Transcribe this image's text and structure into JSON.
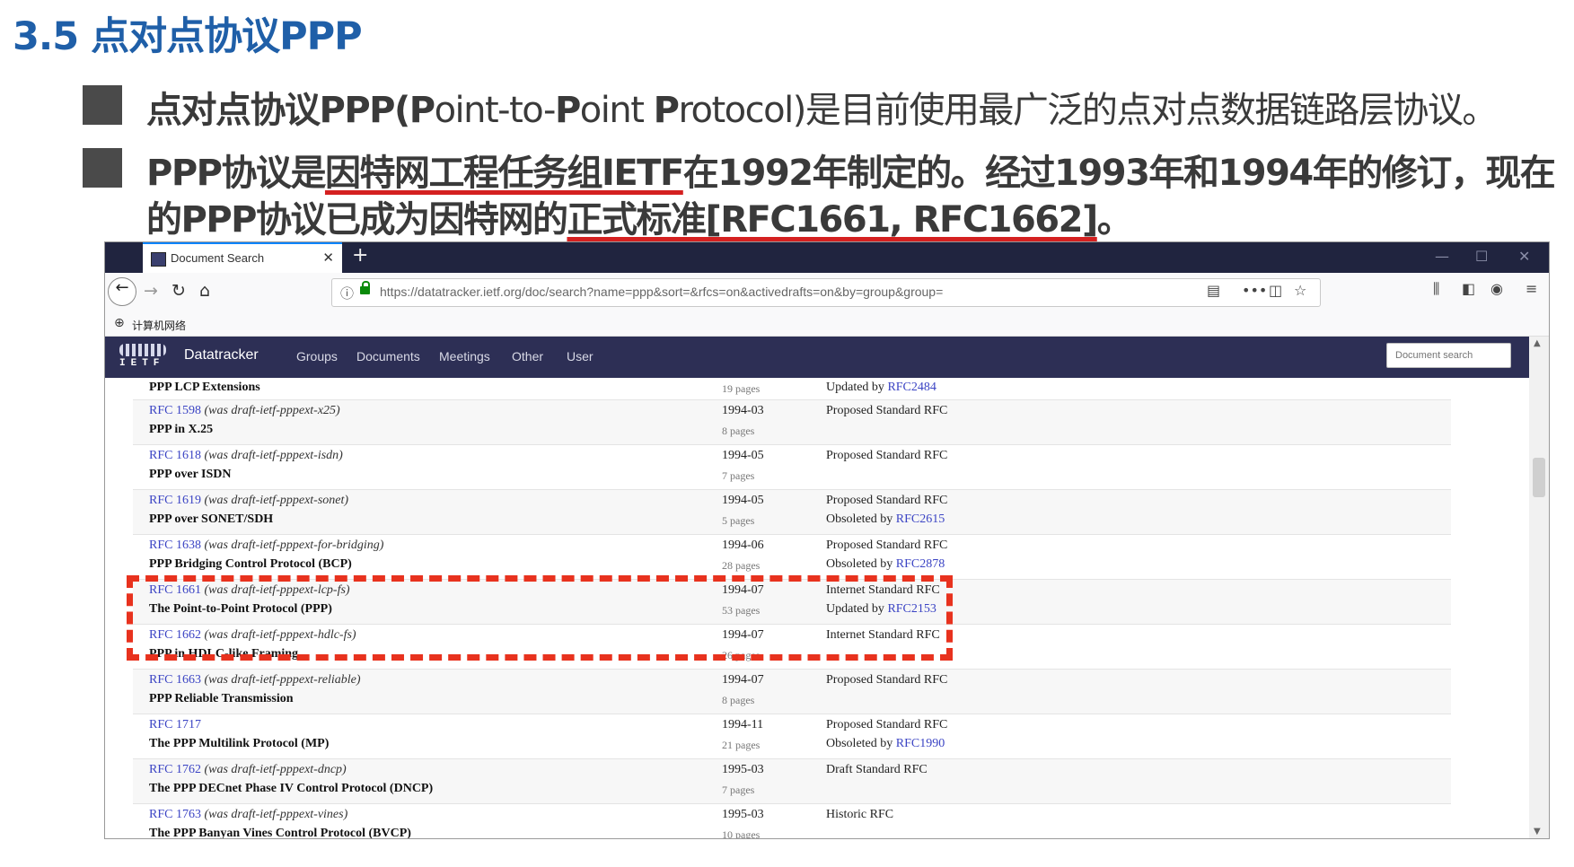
{
  "slide": {
    "title": "3.5 点对点协议PPP",
    "bullet1": {
      "p1": "点对点协议PPP(",
      "p2": "P",
      "p3": "oint-to-",
      "p4": "P",
      "p5": "oint ",
      "p6": "P",
      "p7": "rotocol)是目前使用最广泛的点对点数据链路层协议。"
    },
    "bullet2": {
      "line1_pre": "PPP协议是",
      "line1_hl": "因特网工程任务组IETF",
      "line1_post": "在1992年制定的。经过1993年和1994年的修订，现在",
      "line2_pre": "的PPP协议已成为因特网的",
      "line2_hl": "正式标准[RFC1661, RFC1662]",
      "line2_post": "。"
    }
  },
  "browser": {
    "tab_title": "Document Search",
    "tab_close": "✕",
    "new_tab": "+",
    "win_min": "—",
    "win_max": "☐",
    "win_close": "✕",
    "back": "←",
    "forward": "→",
    "reload": "↻",
    "home": "⌂",
    "url": "https://datatracker.ietf.org/doc/search?name=ppp&sort=&rfcs=on&activedrafts=on&by=group&group=",
    "url_info_icon": "ⓘ",
    "reader_icon": "▤",
    "more_icon": "•••",
    "pocket_icon": "◫",
    "star_icon": "☆",
    "library_icon": "⫼",
    "sidebar_icon": "◧",
    "account_icon": "◉",
    "menu_icon": "≡",
    "bookmark_icon": "⊕",
    "bookmark_label": "计算机网络"
  },
  "ietf": {
    "logo_text": "IETF",
    "brand": "Datatracker",
    "nav": [
      "Groups",
      "Documents",
      "Meetings",
      "Other",
      "User"
    ],
    "search_placeholder": "Document search"
  },
  "rows": [
    {
      "rfc": "",
      "was": "",
      "title": "PPP LCP Extensions",
      "date": "",
      "pages": "19 pages",
      "status": "",
      "status2_pre": "Updated by ",
      "status2_rfc": "RFC2484"
    },
    {
      "rfc": "RFC 1598",
      "was": " (was draft-ietf-pppext-x25)",
      "title": "PPP in X.25",
      "date": "1994-03",
      "pages": "8 pages",
      "status": "Proposed Standard RFC",
      "status2_pre": "",
      "status2_rfc": ""
    },
    {
      "rfc": "RFC 1618",
      "was": " (was draft-ietf-pppext-isdn)",
      "title": "PPP over ISDN",
      "date": "1994-05",
      "pages": "7 pages",
      "status": "Proposed Standard RFC",
      "status2_pre": "",
      "status2_rfc": ""
    },
    {
      "rfc": "RFC 1619",
      "was": " (was draft-ietf-pppext-sonet)",
      "title": "PPP over SONET/SDH",
      "date": "1994-05",
      "pages": "5 pages",
      "status": "Proposed Standard RFC",
      "status2_pre": "Obsoleted by ",
      "status2_rfc": "RFC2615"
    },
    {
      "rfc": "RFC 1638",
      "was": " (was draft-ietf-pppext-for-bridging)",
      "title": "PPP Bridging Control Protocol (BCP)",
      "date": "1994-06",
      "pages": "28 pages",
      "status": "Proposed Standard RFC",
      "status2_pre": "Obsoleted by ",
      "status2_rfc": "RFC2878"
    },
    {
      "rfc": "RFC 1661",
      "was": " (was draft-ietf-pppext-lcp-fs)",
      "title": "The Point-to-Point Protocol (PPP)",
      "date": "1994-07",
      "pages": "53 pages",
      "status": "Internet Standard RFC",
      "status2_pre": "Updated by ",
      "status2_rfc": "RFC2153"
    },
    {
      "rfc": "RFC 1662",
      "was": " (was draft-ietf-pppext-hdlc-fs)",
      "title": "PPP in HDLC-like Framing",
      "date": "1994-07",
      "pages": "26 pages",
      "status": "Internet Standard RFC",
      "status2_pre": "",
      "status2_rfc": ""
    },
    {
      "rfc": "RFC 1663",
      "was": " (was draft-ietf-pppext-reliable)",
      "title": "PPP Reliable Transmission",
      "date": "1994-07",
      "pages": "8 pages",
      "status": "Proposed Standard RFC",
      "status2_pre": "",
      "status2_rfc": ""
    },
    {
      "rfc": "RFC 1717",
      "was": "",
      "title": "The PPP Multilink Protocol (MP)",
      "date": "1994-11",
      "pages": "21 pages",
      "status": "Proposed Standard RFC",
      "status2_pre": "Obsoleted by ",
      "status2_rfc": "RFC1990"
    },
    {
      "rfc": "RFC 1762",
      "was": " (was draft-ietf-pppext-dncp)",
      "title": "The PPP DECnet Phase IV Control Protocol (DNCP)",
      "date": "1995-03",
      "pages": "7 pages",
      "status": "Draft Standard RFC",
      "status2_pre": "",
      "status2_rfc": ""
    },
    {
      "rfc": "RFC 1763",
      "was": " (was draft-ietf-pppext-vines)",
      "title": "The PPP Banyan Vines Control Protocol (BVCP)",
      "date": "1995-03",
      "pages": "10 pages",
      "status": "Historic RFC",
      "status2_pre": "",
      "status2_rfc": ""
    }
  ],
  "colors": {
    "slide_title": "#1f5fa8",
    "highlight": "#d42020",
    "dash_box": "#e8321e",
    "ietf_nav": "#2d2f55",
    "rfc_link": "#3b44c4"
  }
}
